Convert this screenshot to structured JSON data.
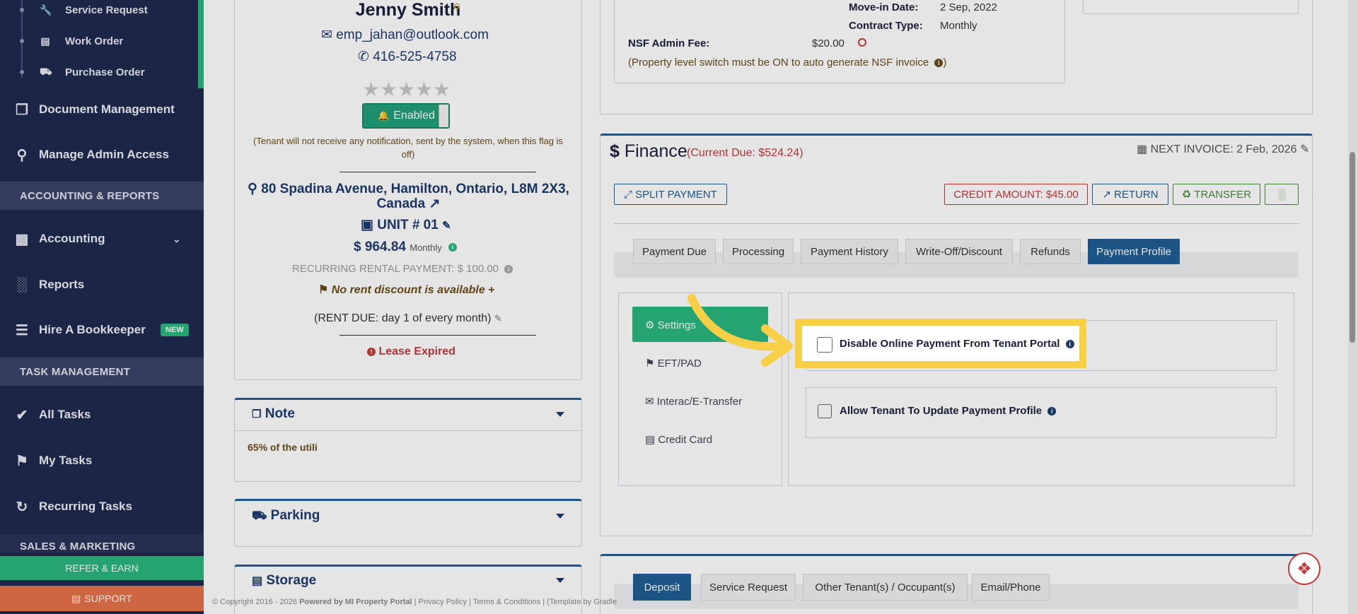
{
  "sidebar": {
    "sub_items": [
      {
        "label": "Service Request",
        "icon": "wrench-icon"
      },
      {
        "label": "Work Order",
        "icon": "documents-icon"
      },
      {
        "label": "Purchase Order",
        "icon": "truck-icon"
      }
    ],
    "items": [
      {
        "label": "Document Management",
        "icon": "files-icon"
      },
      {
        "label": "Manage Admin Access",
        "icon": "key-icon"
      },
      {
        "label": "Accounting",
        "icon": "money-icon"
      },
      {
        "label": "Reports",
        "icon": "bar-chart-icon"
      },
      {
        "label": "Hire A Bookkeeper",
        "icon": "book-icon",
        "badge": "NEW"
      },
      {
        "label": "All Tasks",
        "icon": "check-icon"
      },
      {
        "label": "My Tasks",
        "icon": "tag-icon"
      },
      {
        "label": "Recurring Tasks",
        "icon": "refresh-icon"
      }
    ],
    "sections": [
      "ACCOUNTING & REPORTS",
      "TASK MANAGEMENT",
      "SALES & MARKETING"
    ],
    "refer_label": "REFER & EARN",
    "support_label": "SUPPORT"
  },
  "profile": {
    "name": "Jenny Smith",
    "email": "emp_jahan@outlook.com",
    "phone": "416-525-4758",
    "notification_toggle": "Enabled",
    "notification_note": "(Tenant will not receive any notification, sent by the system, when this flag is off)",
    "address_line1": "80 Spadina Avenue, Hamilton, Ontario, L8M 2X3,",
    "address_line2": "Canada",
    "unit": "UNIT # 01",
    "rent_amount": "$ 964.84",
    "rent_period": "Monthly",
    "recurring": "RECURRING RENTAL PAYMENT: $ 100.00",
    "discount": "No rent discount is available",
    "rent_due": "(RENT DUE: day 1 of every month)",
    "lease_status": "Lease Expired",
    "rating": 0,
    "rating_max": 5
  },
  "cards": {
    "note_title": "Note",
    "note_body": "65% of the utili",
    "parking_title": "Parking",
    "storage_title": "Storage"
  },
  "lease": {
    "move_in_label": "Move-in Date:",
    "move_in_value": "2 Sep, 2022",
    "contract_label": "Contract Type:",
    "contract_value": "Monthly",
    "nsf_label": "NSF Admin Fee:",
    "nsf_value": "$20.00",
    "nsf_note": "(Property level switch must be ON to auto generate NSF invoice"
  },
  "finance": {
    "title": "Finance",
    "current_due": "(Current Due: $524.24)",
    "next_invoice": "NEXT INVOICE: 2 Feb, 2026",
    "split_payment": "SPLIT PAYMENT",
    "credit_amount": "CREDIT AMOUNT: $45.00",
    "return_label": "RETURN",
    "transfer_label": "TRANSFER",
    "tabs": [
      "Payment Due",
      "Processing",
      "Payment History",
      "Write-Off/Discount",
      "Refunds",
      "Payment Profile"
    ],
    "nav": [
      "Settings",
      "EFT/PAD",
      "Interac/E-Transfer",
      "Credit Card"
    ],
    "option_disable": "Disable Online Payment From Tenant Portal",
    "option_allow": "Allow Tenant To Update Payment Profile"
  },
  "bottom_tabs": [
    "Deposit",
    "Service Request",
    "Other Tenant(s) / Occupant(s)",
    "Email/Phone"
  ],
  "footer": {
    "copyright": "© Copyright 2016 - 2026",
    "powered": "Powered by MI Property Portal",
    "links": "| Privacy Policy | Terms & Conditions | (Template by Gradle"
  },
  "colors": {
    "sidebar_bg": "#1f2a4f",
    "accent_green": "#2ab77f",
    "primary_blue": "#1f5e95",
    "highlight_yellow": "#f7cf47",
    "danger_red": "#c23a3a"
  }
}
